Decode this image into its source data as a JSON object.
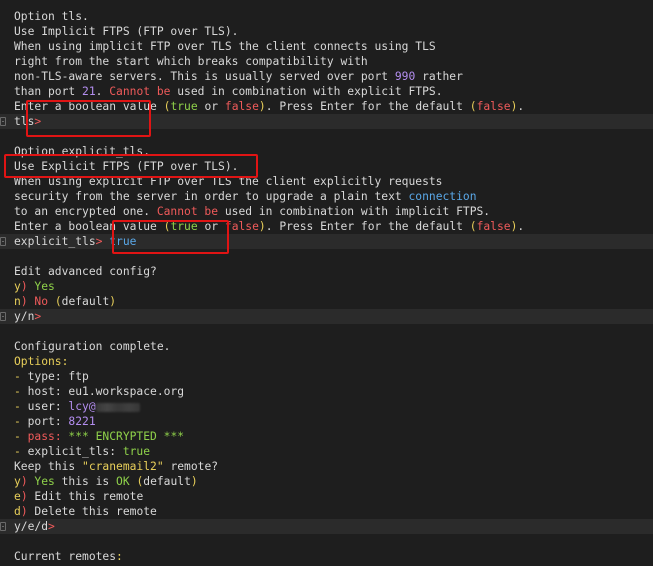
{
  "colors": {
    "background": "#1e1e1e",
    "text": "#d8d8d8",
    "red": "#ef5a5a",
    "green": "#8fd14a",
    "yellow": "#e8cf5a",
    "blue": "#5aa8e8",
    "purple": "#b48ef0",
    "annotation_box": "#e01414"
  },
  "lines": [
    {
      "id": "l01",
      "segments": [
        {
          "t": "Option tls."
        }
      ]
    },
    {
      "id": "l02",
      "segments": [
        {
          "t": "Use Implicit FTPS (FTP over TLS)."
        }
      ]
    },
    {
      "id": "l03",
      "segments": [
        {
          "t": "When using implicit FTP over TLS the client connects using TLS"
        }
      ]
    },
    {
      "id": "l04",
      "segments": [
        {
          "t": "right from the start which breaks compatibility with"
        }
      ]
    },
    {
      "id": "l05",
      "segments": [
        {
          "t": "non-TLS-aware servers. This is usually served over port "
        },
        {
          "t": "990",
          "c": "purple"
        },
        {
          "t": " rather"
        }
      ]
    },
    {
      "id": "l06",
      "segments": [
        {
          "t": "than port "
        },
        {
          "t": "21",
          "c": "purple"
        },
        {
          "t": ". "
        },
        {
          "t": "Cannot be",
          "c": "red"
        },
        {
          "t": " used in combination with explicit FTPS."
        }
      ]
    },
    {
      "id": "l07",
      "segments": [
        {
          "t": "Enter a boolean value "
        },
        {
          "t": "(",
          "c": "yellow"
        },
        {
          "t": "true",
          "c": "green"
        },
        {
          "t": " or "
        },
        {
          "t": "false",
          "c": "red"
        },
        {
          "t": ")",
          "c": "yellow"
        },
        {
          "t": ". Press Enter for the default "
        },
        {
          "t": "(",
          "c": "yellow"
        },
        {
          "t": "false",
          "c": "red"
        },
        {
          "t": ")",
          "c": "yellow"
        },
        {
          "t": "."
        }
      ]
    },
    {
      "id": "l08",
      "hl": true,
      "segments": [
        {
          "t": "tls"
        },
        {
          "t": ">",
          "c": "red"
        }
      ]
    },
    {
      "id": "l09",
      "segments": [
        {
          "t": ""
        }
      ]
    },
    {
      "id": "l10",
      "segments": [
        {
          "t": "Option explicit_tls."
        }
      ]
    },
    {
      "id": "l11",
      "segments": [
        {
          "t": "Use Explicit FTPS (FTP over TLS)."
        }
      ]
    },
    {
      "id": "l12",
      "segments": [
        {
          "t": "When using explicit FTP over TLS the client explicitly requests"
        }
      ]
    },
    {
      "id": "l13",
      "segments": [
        {
          "t": "security from the server in order to upgrade a plain text "
        },
        {
          "t": "connection",
          "c": "blue"
        }
      ]
    },
    {
      "id": "l14",
      "segments": [
        {
          "t": "to an encrypted one. "
        },
        {
          "t": "Cannot be",
          "c": "red"
        },
        {
          "t": " used in combination with implicit FTPS."
        }
      ]
    },
    {
      "id": "l15",
      "segments": [
        {
          "t": "Enter a boolean value "
        },
        {
          "t": "(",
          "c": "yellow"
        },
        {
          "t": "true",
          "c": "green"
        },
        {
          "t": " or "
        },
        {
          "t": "false",
          "c": "red"
        },
        {
          "t": ")",
          "c": "yellow"
        },
        {
          "t": ". Press Enter for the default "
        },
        {
          "t": "(",
          "c": "yellow"
        },
        {
          "t": "false",
          "c": "red"
        },
        {
          "t": ")",
          "c": "yellow"
        },
        {
          "t": "."
        }
      ]
    },
    {
      "id": "l16",
      "hl": true,
      "segments": [
        {
          "t": "explicit_tls"
        },
        {
          "t": ">",
          "c": "red"
        },
        {
          "t": " true",
          "c": "blue"
        }
      ]
    },
    {
      "id": "l17",
      "segments": [
        {
          "t": ""
        }
      ]
    },
    {
      "id": "l18",
      "segments": [
        {
          "t": "Edit advanced config?"
        }
      ]
    },
    {
      "id": "l19",
      "segments": [
        {
          "t": "y",
          "c": "yellow"
        },
        {
          "t": ") ",
          "c": "red"
        },
        {
          "t": "Yes",
          "c": "green"
        }
      ]
    },
    {
      "id": "l20",
      "segments": [
        {
          "t": "n",
          "c": "yellow"
        },
        {
          "t": ") ",
          "c": "red"
        },
        {
          "t": "No",
          "c": "red"
        },
        {
          "t": " "
        },
        {
          "t": "(",
          "c": "yellow"
        },
        {
          "t": "default"
        },
        {
          "t": ")",
          "c": "yellow"
        }
      ]
    },
    {
      "id": "l21",
      "hl": true,
      "segments": [
        {
          "t": "y/n"
        },
        {
          "t": ">",
          "c": "red"
        }
      ]
    },
    {
      "id": "l22",
      "segments": [
        {
          "t": ""
        }
      ]
    },
    {
      "id": "l23",
      "segments": [
        {
          "t": "Configuration complete."
        }
      ]
    },
    {
      "id": "l24",
      "segments": [
        {
          "t": "Options",
          "c": "yellow"
        },
        {
          "t": ":",
          "c": "yellow"
        }
      ]
    },
    {
      "id": "l25",
      "segments": [
        {
          "t": "- ",
          "c": "yellow"
        },
        {
          "t": "type: ftp"
        }
      ]
    },
    {
      "id": "l26",
      "segments": [
        {
          "t": "- ",
          "c": "yellow"
        },
        {
          "t": "host: eu1.workspace.org"
        }
      ]
    },
    {
      "id": "l27",
      "segments": [
        {
          "t": "- ",
          "c": "yellow"
        },
        {
          "t": "user: "
        },
        {
          "t": "lcy@",
          "c": "purple"
        },
        {
          "redacted": true
        }
      ]
    },
    {
      "id": "l28",
      "segments": [
        {
          "t": "- ",
          "c": "yellow"
        },
        {
          "t": "port: "
        },
        {
          "t": "8221",
          "c": "purple"
        }
      ]
    },
    {
      "id": "l29",
      "segments": [
        {
          "t": "- ",
          "c": "yellow"
        },
        {
          "t": "pass: ",
          "c": "red"
        },
        {
          "t": "*** ENCRYPTED ***",
          "c": "green"
        }
      ]
    },
    {
      "id": "l30",
      "segments": [
        {
          "t": "- ",
          "c": "yellow"
        },
        {
          "t": "explicit_tls: "
        },
        {
          "t": "true",
          "c": "green"
        }
      ]
    },
    {
      "id": "l31",
      "segments": [
        {
          "t": "Keep this "
        },
        {
          "t": "\"cranemail2\"",
          "c": "yellow"
        },
        {
          "t": " remote?"
        }
      ]
    },
    {
      "id": "l32",
      "segments": [
        {
          "t": "y",
          "c": "yellow"
        },
        {
          "t": ") ",
          "c": "red"
        },
        {
          "t": "Yes",
          "c": "green"
        },
        {
          "t": " this is "
        },
        {
          "t": "OK",
          "c": "green"
        },
        {
          "t": " "
        },
        {
          "t": "(",
          "c": "yellow"
        },
        {
          "t": "default"
        },
        {
          "t": ")",
          "c": "yellow"
        }
      ]
    },
    {
      "id": "l33",
      "segments": [
        {
          "t": "e",
          "c": "yellow"
        },
        {
          "t": ") ",
          "c": "red"
        },
        {
          "t": "Edit this remote"
        }
      ]
    },
    {
      "id": "l34",
      "segments": [
        {
          "t": "d",
          "c": "yellow"
        },
        {
          "t": ") ",
          "c": "red"
        },
        {
          "t": "Delete this remote"
        }
      ]
    },
    {
      "id": "l35",
      "hl": true,
      "segments": [
        {
          "t": "y/e/d"
        },
        {
          "t": ">",
          "c": "red"
        }
      ]
    },
    {
      "id": "l36",
      "segments": [
        {
          "t": ""
        }
      ]
    },
    {
      "id": "l37",
      "segments": [
        {
          "t": "Current remotes"
        },
        {
          "t": ":",
          "c": "yellow"
        }
      ]
    }
  ]
}
